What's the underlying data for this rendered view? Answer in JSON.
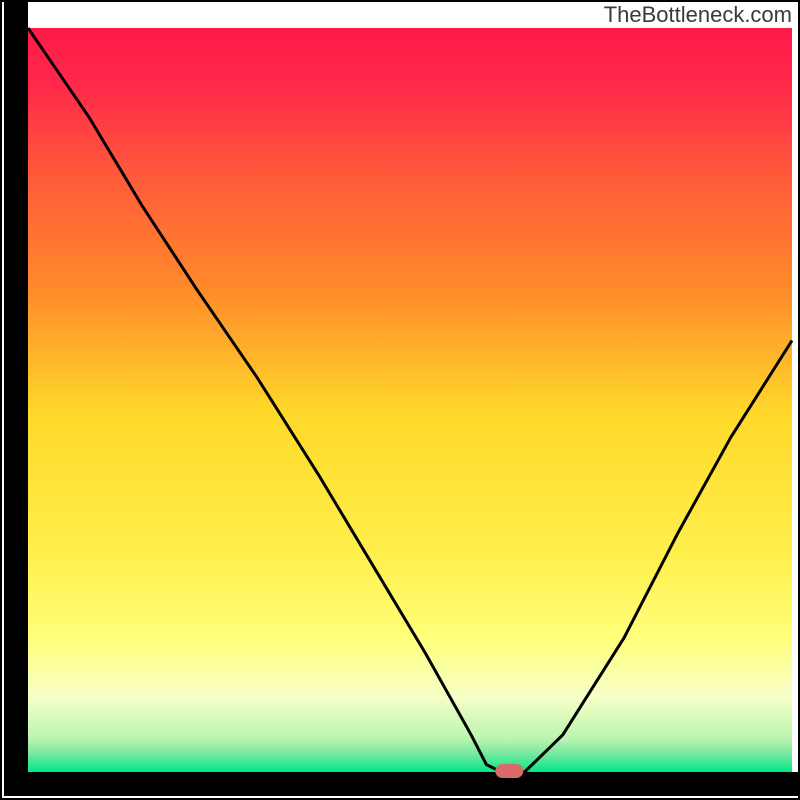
{
  "watermark": "TheBottleneck.com",
  "chart_data": {
    "type": "line",
    "title": "",
    "xlabel": "",
    "ylabel": "",
    "xlim": [
      0,
      100
    ],
    "ylim": [
      0,
      100
    ],
    "x": [
      0,
      8,
      15,
      22,
      30,
      38,
      45,
      52,
      58,
      60,
      62,
      65,
      70,
      78,
      85,
      92,
      100
    ],
    "values": [
      100,
      88,
      76,
      65,
      53,
      40,
      28,
      16,
      5,
      1,
      0,
      0,
      5,
      18,
      32,
      45,
      58
    ],
    "marker": {
      "x": 63,
      "y": 0,
      "color": "#d86a6a"
    },
    "colors": {
      "gradient_top": "#ff1a4a",
      "gradient_mid_upper": "#ff8a2a",
      "gradient_mid": "#ffd92a",
      "gradient_mid_lower": "#ffff7a",
      "gradient_lower": "#f6ffc8",
      "gradient_bottom": "#00e88a",
      "line": "#000000",
      "axis": "#000000"
    }
  }
}
